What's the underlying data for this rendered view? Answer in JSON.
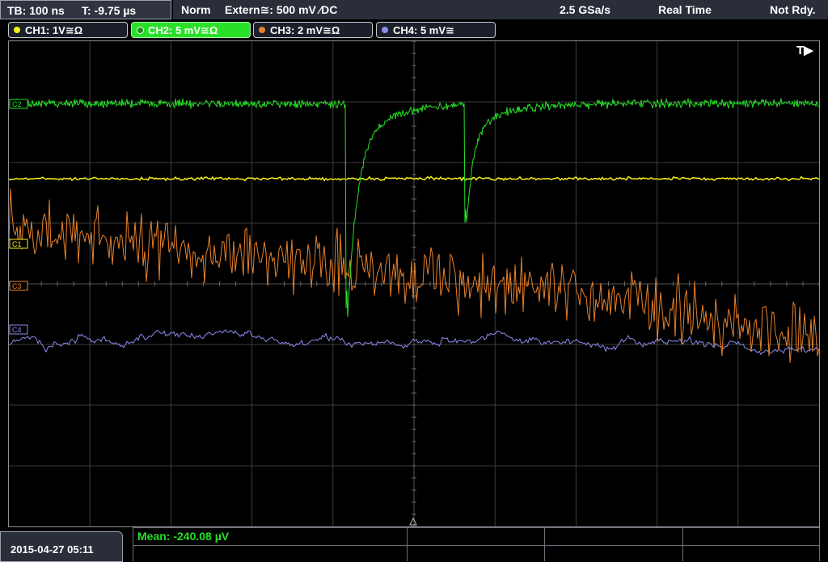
{
  "timebase": {
    "tb": "TB: 100 ns",
    "trigger_time": "T: -9.75 µs"
  },
  "status": {
    "mode": "Norm",
    "trigger": "Extern≅: 500 mV ∕DC",
    "sample_rate": "2.5 GSa/s",
    "acquisition": "Real Time",
    "state": "Not Rdy."
  },
  "channels": [
    {
      "label": "CH1: 1V≅Ω",
      "color": "#f5f01a",
      "active": false
    },
    {
      "label": "CH2: 5 mV≅Ω",
      "color": "#27e027",
      "active": true
    },
    {
      "label": "CH3: 2 mV≅Ω",
      "color": "#e8812a",
      "active": false
    },
    {
      "label": "CH4: 5 mV≅",
      "color": "#8c8cf0",
      "active": false
    }
  ],
  "markers": {
    "trigger_marker": "T▶",
    "ch1": "C1",
    "ch2": "C2",
    "ch3": "C3",
    "ch4": "C4"
  },
  "footer": {
    "datetime": "2015-04-27 05:11",
    "mean": "Mean: -240.08 µV"
  },
  "colors": {
    "grid": "#3c3c3c",
    "frame": "#8d8f98",
    "ch1": "#f5f01a",
    "ch2": "#27e027",
    "ch3": "#e8812a",
    "ch4": "#8c8cf0"
  },
  "chart_data": {
    "type": "line",
    "x": {
      "unit": "ns",
      "per_division": 100,
      "divisions": 10
    },
    "series": [
      {
        "name": "CH1",
        "description": "flat level with fine noise"
      },
      {
        "name": "CH2",
        "description": "noisy baseline with two sharp negative pulses and exponential recovery"
      },
      {
        "name": "CH3",
        "description": "large-amplitude noisy signal drifting downward"
      },
      {
        "name": "CH4",
        "description": "low-amplitude noisy signal drifting slightly downward"
      }
    ]
  }
}
